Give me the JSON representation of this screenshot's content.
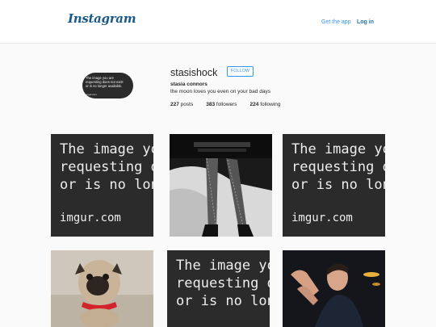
{
  "header": {
    "logo": "Instagram",
    "get_app": "Get the app",
    "login": "Log in"
  },
  "profile": {
    "avatar_text": [
      "The image you are",
      "requesting does not exist",
      "or is no longer available.",
      "imgur.com"
    ],
    "username": "stasishock",
    "follow": "FOLLOW",
    "full_name": "stasia connors",
    "bio": "the moon loves you even on your bad days",
    "stats": {
      "posts": "227",
      "posts_label": "posts",
      "followers": "383",
      "followers_label": "followers",
      "following": "224",
      "following_label": "following"
    }
  },
  "posts": {
    "removed_text": [
      "The image yo",
      "requesting d",
      "or is no longe",
      "imgur.com"
    ],
    "removed_text_short": [
      "The image yo",
      "requesting d",
      "or is no longe"
    ],
    "photo_subjects": [
      "legs-in-fishnet-stockings",
      "pug-dog-on-sand",
      "person-in-dark-room"
    ]
  },
  "colors": {
    "accent": "#3897f0",
    "logo": "#1a5a8a",
    "placeholder_bg": "#2b2b2b"
  }
}
